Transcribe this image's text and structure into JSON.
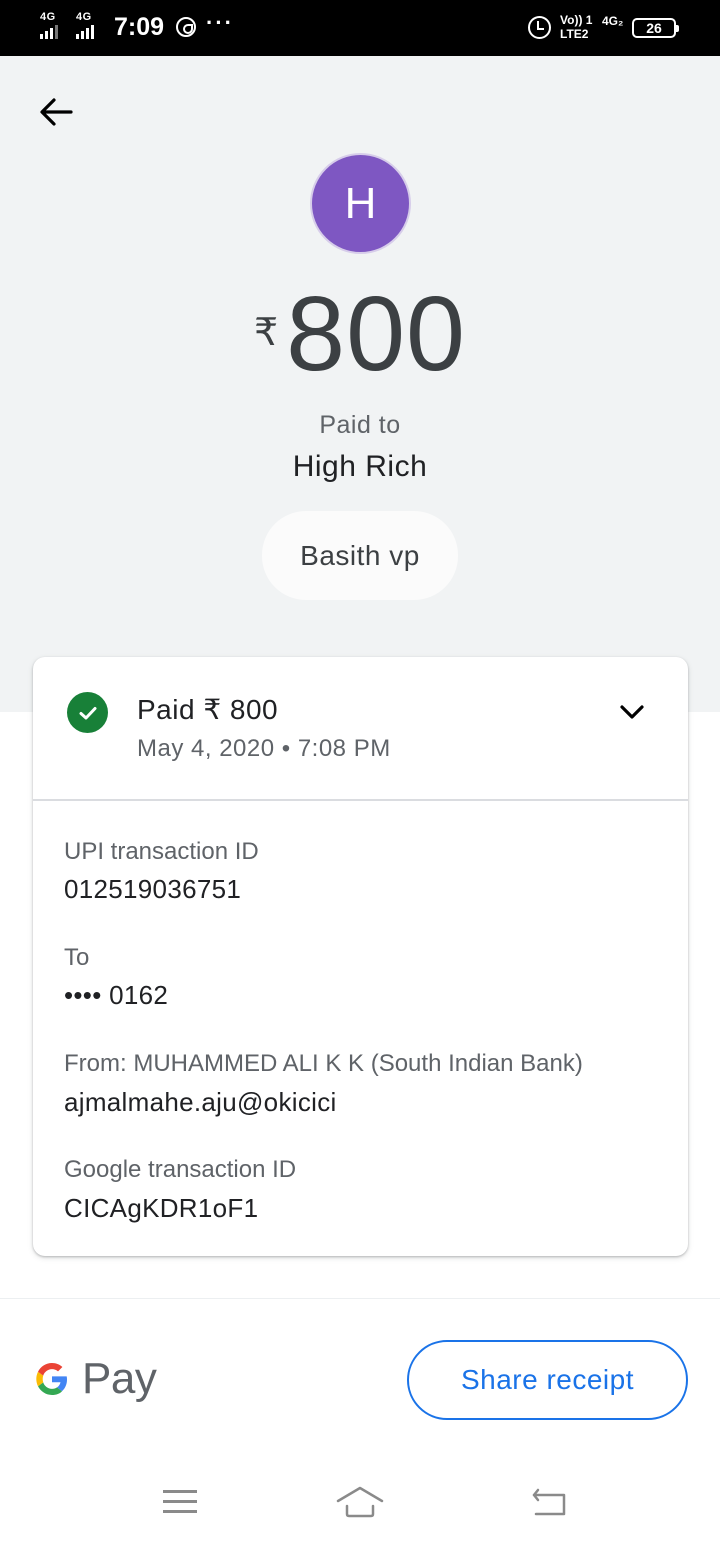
{
  "status_bar": {
    "sim1": "4G",
    "sim2": "4G",
    "time": "7:09",
    "more": "···",
    "volte_line1": "Vo)) 1",
    "volte_line2": "LTE2",
    "net2": "4G₂",
    "battery": "26"
  },
  "header": {
    "avatar_letter": "H",
    "avatar_color": "#7e57c2",
    "currency": "₹",
    "amount": "800",
    "paid_to_label": "Paid to",
    "payee_name": "High Rich",
    "chip_label": "Basith vp"
  },
  "card": {
    "status_title": "Paid ₹ 800",
    "datetime": "May 4, 2020 • 7:08 PM",
    "details": {
      "upi_label": "UPI transaction ID",
      "upi_value": "012519036751",
      "to_label": "To",
      "to_value": "•••• 0162",
      "from_label": "From: MUHAMMED ALI K K (South Indian Bank)",
      "from_value": "ajmalmahe.aju@okicici",
      "google_label": "Google transaction ID",
      "google_value": "CICAgKDR1oF1"
    }
  },
  "footer": {
    "brand": "Pay",
    "share_label": "Share receipt",
    "accent": "#1a73e8"
  },
  "icons": {
    "back": "arrow-back-icon",
    "check": "check-circle-icon",
    "expand": "chevron-down-icon",
    "menu": "menu-icon",
    "home": "home-icon",
    "return": "back-nav-icon"
  }
}
